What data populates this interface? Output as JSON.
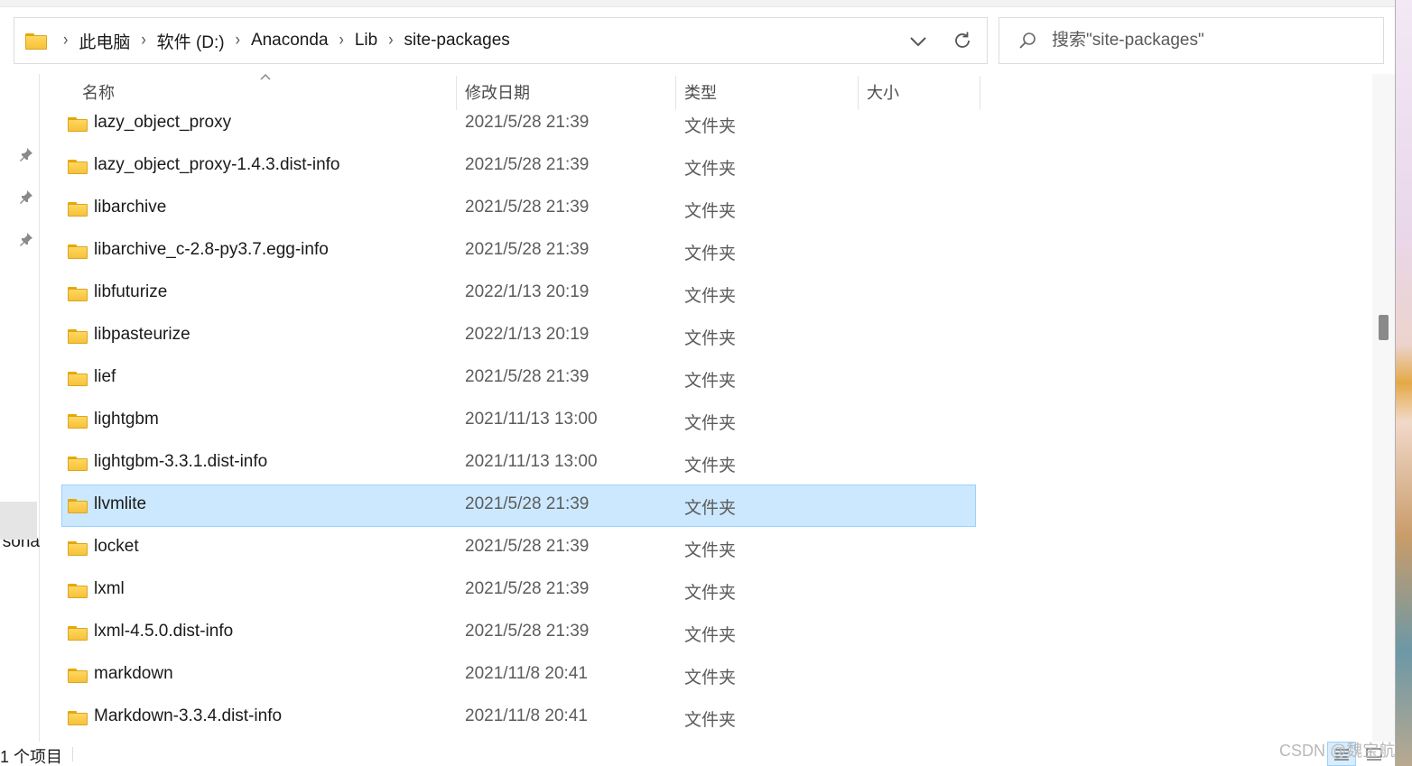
{
  "address_bar": {
    "crumbs": [
      "此电脑",
      "软件 (D:)",
      "Anaconda",
      "Lib",
      "site-packages"
    ]
  },
  "search": {
    "placeholder": "搜索\"site-packages\""
  },
  "columns": {
    "name": "名称",
    "date": "修改日期",
    "type": "类型",
    "size": "大小"
  },
  "rows": [
    {
      "name": "lazy_object_proxy",
      "date": "2021/5/28 21:39",
      "type": "文件夹"
    },
    {
      "name": "lazy_object_proxy-1.4.3.dist-info",
      "date": "2021/5/28 21:39",
      "type": "文件夹"
    },
    {
      "name": "libarchive",
      "date": "2021/5/28 21:39",
      "type": "文件夹"
    },
    {
      "name": "libarchive_c-2.8-py3.7.egg-info",
      "date": "2021/5/28 21:39",
      "type": "文件夹"
    },
    {
      "name": "libfuturize",
      "date": "2022/1/13 20:19",
      "type": "文件夹"
    },
    {
      "name": "libpasteurize",
      "date": "2022/1/13 20:19",
      "type": "文件夹"
    },
    {
      "name": "lief",
      "date": "2021/5/28 21:39",
      "type": "文件夹"
    },
    {
      "name": "lightgbm",
      "date": "2021/11/13 13:00",
      "type": "文件夹"
    },
    {
      "name": "lightgbm-3.3.1.dist-info",
      "date": "2021/11/13 13:00",
      "type": "文件夹"
    },
    {
      "name": "llvmlite",
      "date": "2021/5/28 21:39",
      "type": "文件夹",
      "selected": true
    },
    {
      "name": "locket",
      "date": "2021/5/28 21:39",
      "type": "文件夹"
    },
    {
      "name": "lxml",
      "date": "2021/5/28 21:39",
      "type": "文件夹"
    },
    {
      "name": "lxml-4.5.0.dist-info",
      "date": "2021/5/28 21:39",
      "type": "文件夹"
    },
    {
      "name": "markdown",
      "date": "2021/11/8 20:41",
      "type": "文件夹"
    },
    {
      "name": "Markdown-3.3.4.dist-info",
      "date": "2021/11/8 20:41",
      "type": "文件夹"
    }
  ],
  "nav": {
    "partial_label": "rsona"
  },
  "status": {
    "count": "1 个项目"
  },
  "watermark": "CSDN @魏宝航",
  "colors": {
    "selection_bg": "#cce8ff",
    "selection_border": "#99d1ff",
    "folder": "#f6c23a"
  }
}
